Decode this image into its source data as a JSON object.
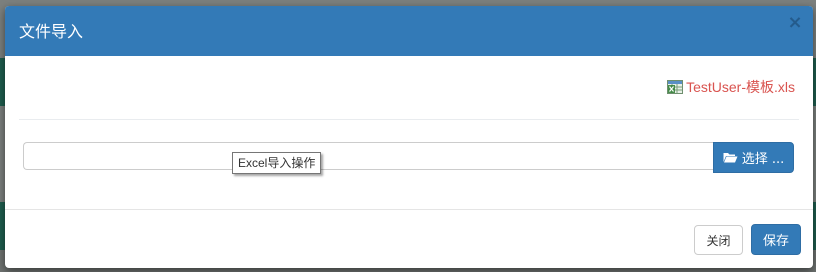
{
  "modal": {
    "title": "文件导入",
    "close_symbol": "×",
    "template_link_text": "TestUser-模板.xls",
    "template_icon": "excel-file-icon",
    "file_input_value": "",
    "choose_button_label": "选择 ...",
    "choose_button_icon": "folder-open-icon",
    "tooltip_text": "Excel导入操作",
    "footer": {
      "close_label": "关闭",
      "save_label": "保存"
    }
  },
  "colors": {
    "primary": "#337ab7",
    "link_red": "#d9534f"
  }
}
